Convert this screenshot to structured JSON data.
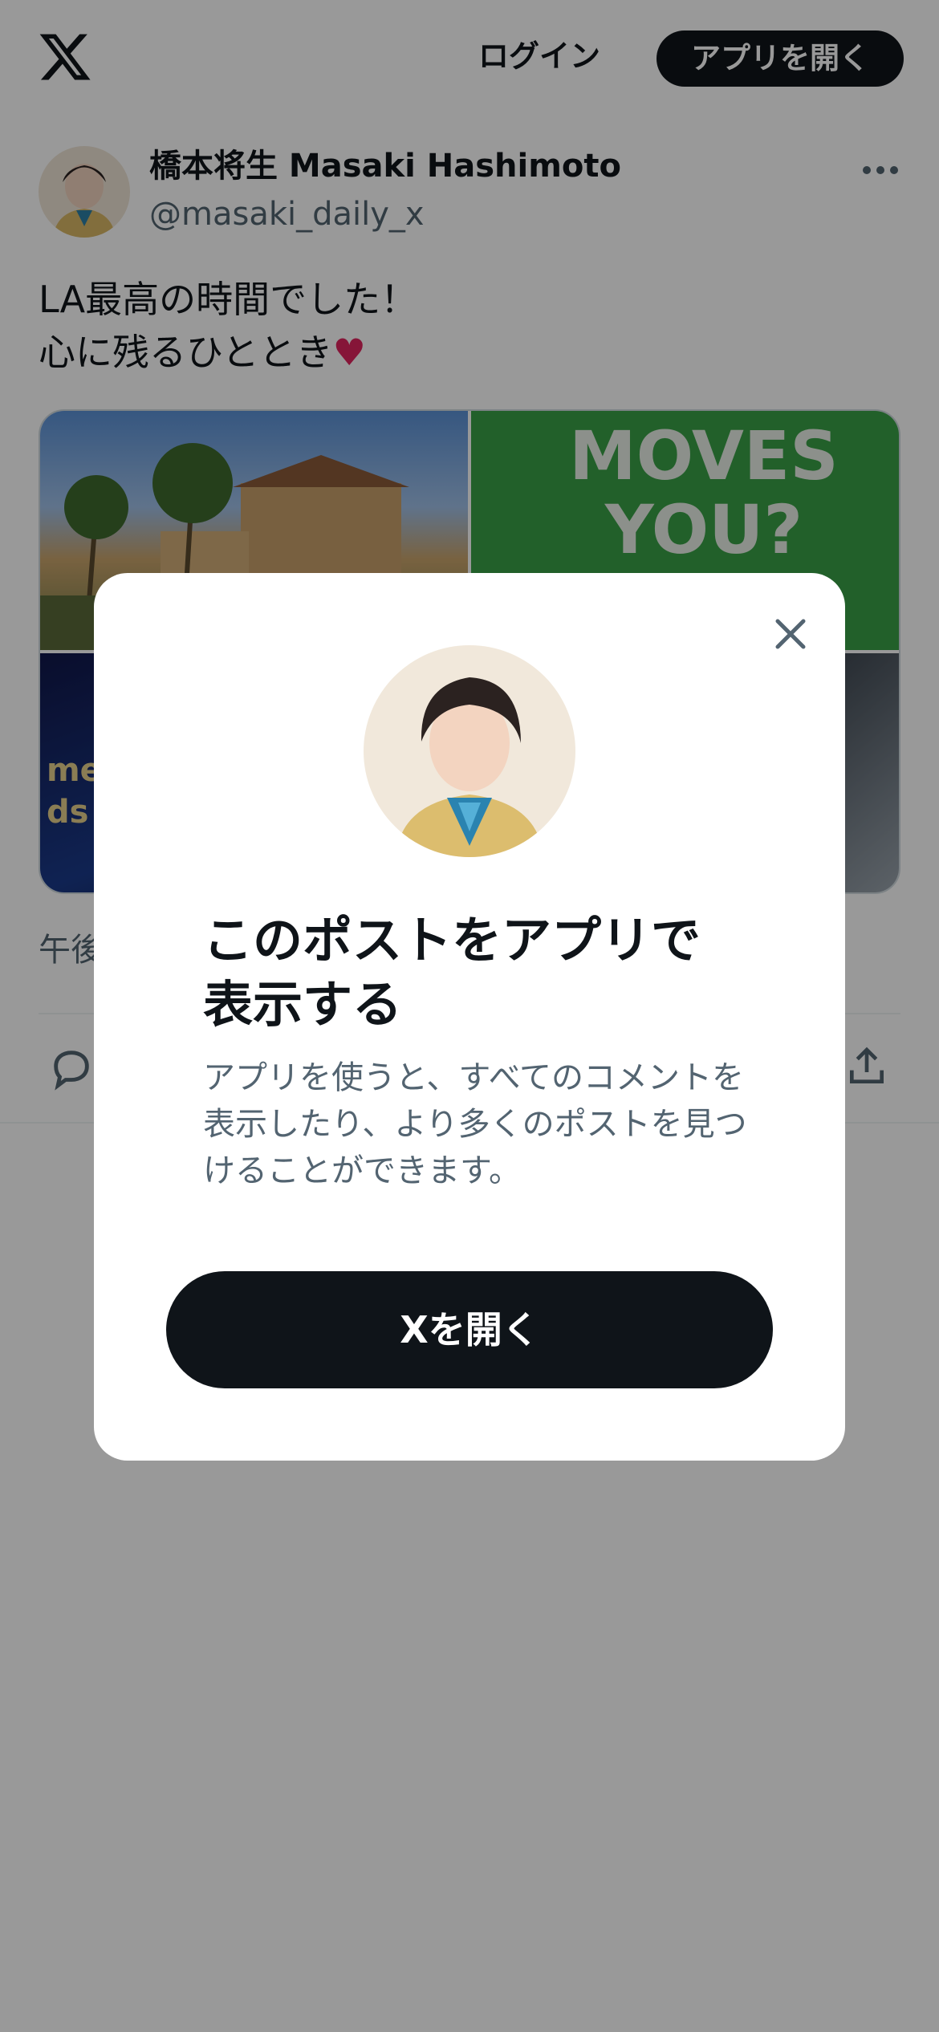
{
  "header": {
    "login_label": "ログイン",
    "open_app_label": "アプリを開く"
  },
  "post": {
    "author_name": "橋本将生 Masaki Hashimoto",
    "author_handle": "@masaki_daily_x",
    "text_line1": "LA最高の時間でした！",
    "text_line2": "心に残るひととき",
    "heart": "♥",
    "timestamp": "午後",
    "media": {
      "tile2_text": "MOVES YOU?",
      "tile3_text_line1": "me",
      "tile3_text_line2": "ds"
    }
  },
  "modal": {
    "title": "このポストをアプリで表示する",
    "description": "アプリを使うと、すべてのコメントを表示したり、より多くのポストを見つけることができます。",
    "cta_label": "Xを開く"
  },
  "colors": {
    "text_primary": "#0f1419",
    "text_secondary": "#536471",
    "button_dark": "#0f1419",
    "overlay": "rgba(0,0,0,0.4)",
    "heart": "#e0245e"
  },
  "icons": [
    "x-logo-icon",
    "more-icon",
    "reply-icon",
    "share-icon",
    "close-icon"
  ]
}
